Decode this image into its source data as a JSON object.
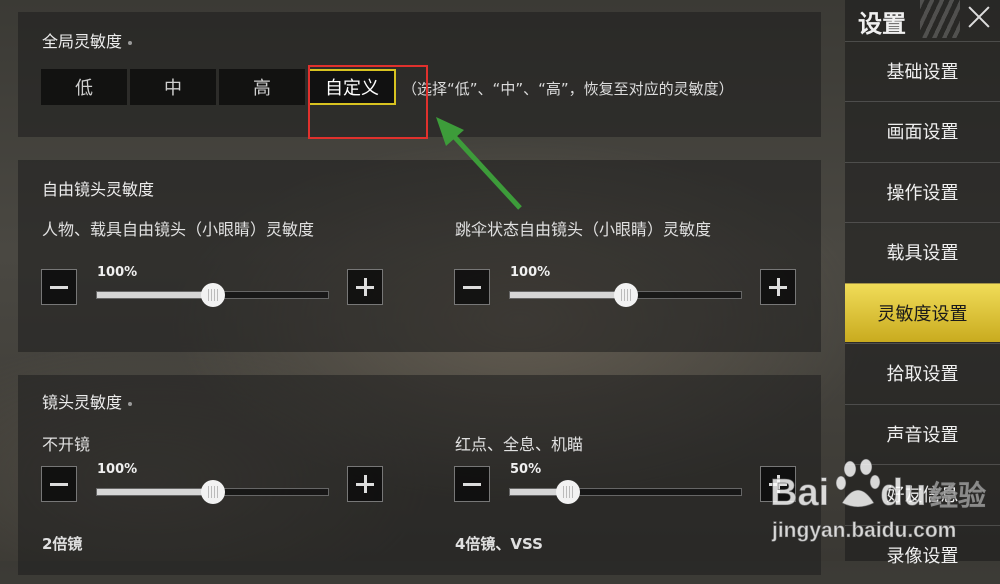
{
  "global": {
    "title": "全局灵敏度",
    "presets": [
      "低",
      "中",
      "高",
      "自定义"
    ],
    "hint": "（选择“低”、“中”、“高”，恢复至对应的灵敏度）"
  },
  "free_camera": {
    "title": "自由镜头灵敏度",
    "left": {
      "label": "人物、载具自由镜头（小眼睛）灵敏度",
      "value": "100%",
      "level": 0.5
    },
    "right": {
      "label": "跳伞状态自由镜头（小眼睛）灵敏度",
      "value": "100%",
      "level": 0.5
    }
  },
  "camera": {
    "title": "镜头灵敏度",
    "left": {
      "label": "不开镜",
      "value": "100%",
      "level": 0.5
    },
    "right": {
      "label": "红点、全息、机瞄",
      "value": "50%",
      "level": 0.25
    },
    "next_left": "2倍镜",
    "next_right": "4倍镜、VSS"
  },
  "sidebar": {
    "title": "设置",
    "items": [
      "基础设置",
      "画面设置",
      "操作设置",
      "载具设置",
      "灵敏度设置",
      "拾取设置",
      "声音设置",
      "好友信息",
      "录像设置"
    ],
    "active_index": 4
  },
  "watermark": {
    "brand": "Bai",
    "du": "du",
    "site": "jingyan.baidu.com",
    "suffix": "经验"
  },
  "colors": {
    "accent": "#e2c93a",
    "annotation_box": "#e0312d",
    "arrow": "#3d9c3a"
  }
}
